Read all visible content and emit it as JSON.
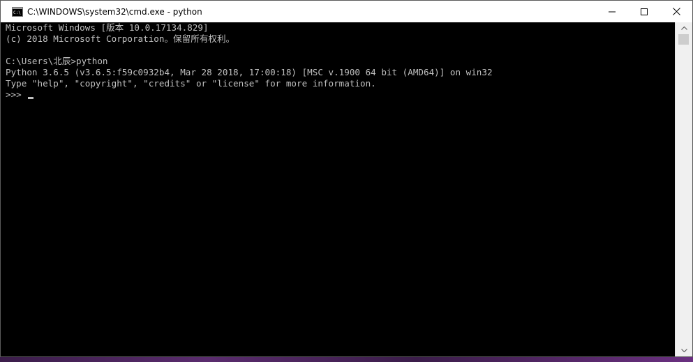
{
  "window": {
    "title": "C:\\WINDOWS\\system32\\cmd.exe - python",
    "icon": "cmd-icon",
    "buttons": [
      "minimize-icon",
      "maximize-icon",
      "close-icon"
    ]
  },
  "console": {
    "lines": [
      "Microsoft Windows [版本 10.0.17134.829]",
      "(c) 2018 Microsoft Corporation。保留所有权利。",
      "",
      "C:\\Users\\北辰>python",
      "Python 3.6.5 (v3.6.5:f59c0932b4, Mar 28 2018, 17:00:18) [MSC v.1900 64 bit (AMD64)] on win32",
      "Type \"help\", \"copyright\", \"credits\" or \"license\" for more information."
    ],
    "prompt": ">>>"
  },
  "colors": {
    "background": "#000000",
    "text": "#c0c0c0",
    "titlebar": "#ffffff"
  }
}
